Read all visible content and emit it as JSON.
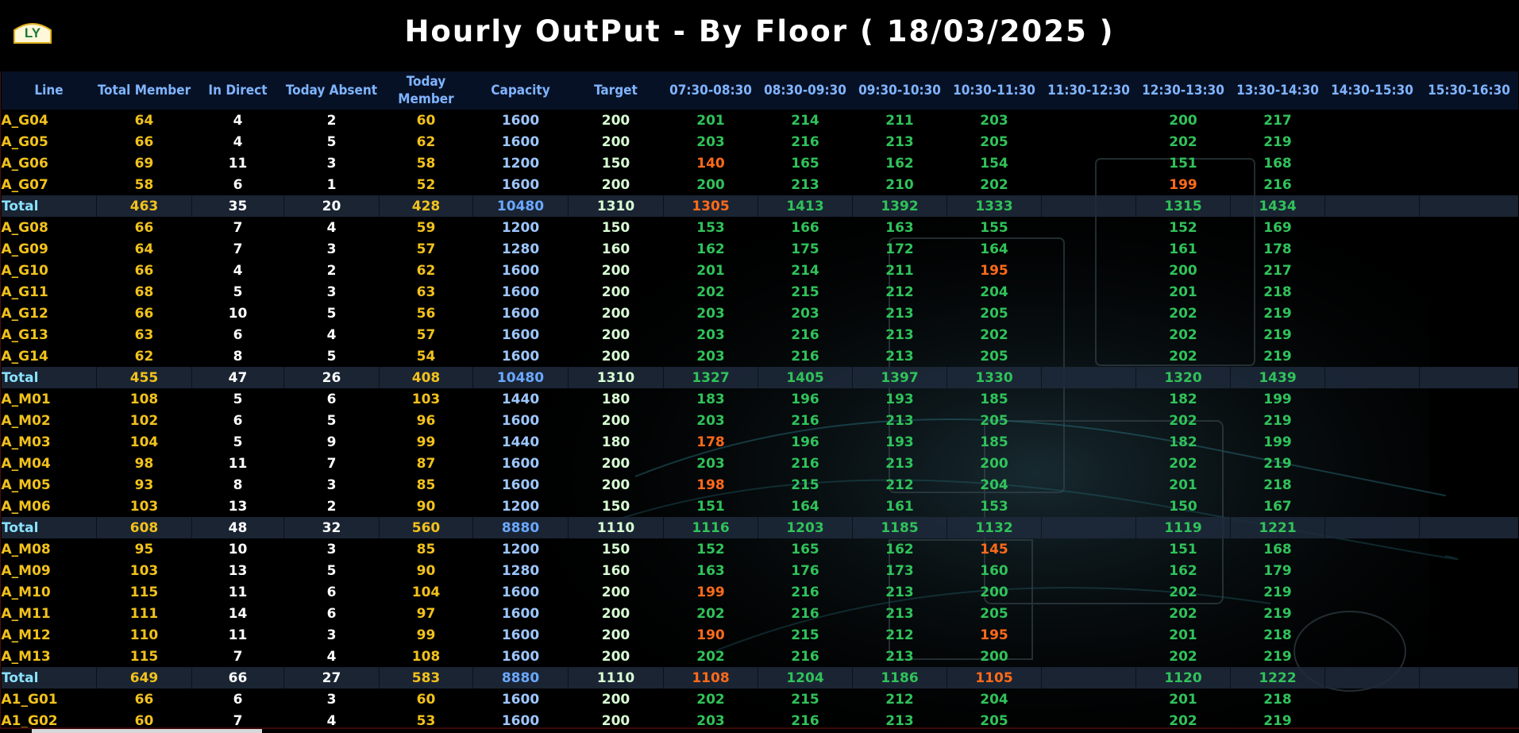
{
  "header": {
    "title": "Hourly OutPut - By Floor ( 18/03/2025 )",
    "logo_text": "LY"
  },
  "colors": {
    "line_and_members": "#f2c21c",
    "meets_target": "#30c25a",
    "below_target": "#ff6a1a",
    "header_text": "#7fb4ff",
    "total_row_bg": "#1e2a3c"
  },
  "columns": [
    "Line",
    "Total Member",
    "In Direct",
    "Today Absent",
    "Today Member",
    "Capacity",
    "Target",
    "07:30-08:30",
    "08:30-09:30",
    "09:30-10:30",
    "10:30-11:30",
    "11:30-12:30",
    "12:30-13:30",
    "13:30-14:30",
    "14:30-15:30",
    "15:30-16:30"
  ],
  "rows": [
    {
      "line": "A_G04",
      "total": "64",
      "indirect": "4",
      "absent": "2",
      "today": "60",
      "capacity": "1600",
      "target": "200",
      "h": [
        "201",
        "214",
        "211",
        "203",
        "",
        "200",
        "217",
        "",
        ""
      ],
      "s": [
        "ok",
        "ok",
        "ok",
        "ok",
        "",
        "ok",
        "ok",
        "",
        ""
      ]
    },
    {
      "line": "A_G05",
      "total": "66",
      "indirect": "4",
      "absent": "5",
      "today": "62",
      "capacity": "1600",
      "target": "200",
      "h": [
        "203",
        "216",
        "213",
        "205",
        "",
        "202",
        "219",
        "",
        ""
      ],
      "s": [
        "ok",
        "ok",
        "ok",
        "ok",
        "",
        "ok",
        "ok",
        "",
        ""
      ]
    },
    {
      "line": "A_G06",
      "total": "69",
      "indirect": "11",
      "absent": "3",
      "today": "58",
      "capacity": "1200",
      "target": "150",
      "h": [
        "140",
        "165",
        "162",
        "154",
        "",
        "151",
        "168",
        "",
        ""
      ],
      "s": [
        "low",
        "ok",
        "ok",
        "ok",
        "",
        "ok",
        "ok",
        "",
        ""
      ]
    },
    {
      "line": "A_G07",
      "total": "58",
      "indirect": "6",
      "absent": "1",
      "today": "52",
      "capacity": "1600",
      "target": "200",
      "h": [
        "200",
        "213",
        "210",
        "202",
        "",
        "199",
        "216",
        "",
        ""
      ],
      "s": [
        "ok",
        "ok",
        "ok",
        "ok",
        "",
        "low",
        "ok",
        "",
        ""
      ]
    },
    {
      "line": "Total",
      "total": "463",
      "indirect": "35",
      "absent": "20",
      "today": "428",
      "capacity": "10480",
      "target": "1310",
      "h": [
        "1305",
        "1413",
        "1392",
        "1333",
        "",
        "1315",
        "1434",
        "",
        ""
      ],
      "s": [
        "low",
        "ok",
        "ok",
        "ok",
        "",
        "ok",
        "ok",
        "",
        ""
      ],
      "is_total": true
    },
    {
      "line": "A_G08",
      "total": "66",
      "indirect": "7",
      "absent": "4",
      "today": "59",
      "capacity": "1200",
      "target": "150",
      "h": [
        "153",
        "166",
        "163",
        "155",
        "",
        "152",
        "169",
        "",
        ""
      ],
      "s": [
        "ok",
        "ok",
        "ok",
        "ok",
        "",
        "ok",
        "ok",
        "",
        ""
      ]
    },
    {
      "line": "A_G09",
      "total": "64",
      "indirect": "7",
      "absent": "3",
      "today": "57",
      "capacity": "1280",
      "target": "160",
      "h": [
        "162",
        "175",
        "172",
        "164",
        "",
        "161",
        "178",
        "",
        ""
      ],
      "s": [
        "ok",
        "ok",
        "ok",
        "ok",
        "",
        "ok",
        "ok",
        "",
        ""
      ]
    },
    {
      "line": "A_G10",
      "total": "66",
      "indirect": "4",
      "absent": "2",
      "today": "62",
      "capacity": "1600",
      "target": "200",
      "h": [
        "201",
        "214",
        "211",
        "195",
        "",
        "200",
        "217",
        "",
        ""
      ],
      "s": [
        "ok",
        "ok",
        "ok",
        "low",
        "",
        "ok",
        "ok",
        "",
        ""
      ]
    },
    {
      "line": "A_G11",
      "total": "68",
      "indirect": "5",
      "absent": "3",
      "today": "63",
      "capacity": "1600",
      "target": "200",
      "h": [
        "202",
        "215",
        "212",
        "204",
        "",
        "201",
        "218",
        "",
        ""
      ],
      "s": [
        "ok",
        "ok",
        "ok",
        "ok",
        "",
        "ok",
        "ok",
        "",
        ""
      ]
    },
    {
      "line": "A_G12",
      "total": "66",
      "indirect": "10",
      "absent": "5",
      "today": "56",
      "capacity": "1600",
      "target": "200",
      "h": [
        "203",
        "203",
        "213",
        "205",
        "",
        "202",
        "219",
        "",
        ""
      ],
      "s": [
        "ok",
        "ok",
        "ok",
        "ok",
        "",
        "ok",
        "ok",
        "",
        ""
      ]
    },
    {
      "line": "A_G13",
      "total": "63",
      "indirect": "6",
      "absent": "4",
      "today": "57",
      "capacity": "1600",
      "target": "200",
      "h": [
        "203",
        "216",
        "213",
        "202",
        "",
        "202",
        "219",
        "",
        ""
      ],
      "s": [
        "ok",
        "ok",
        "ok",
        "ok",
        "",
        "ok",
        "ok",
        "",
        ""
      ]
    },
    {
      "line": "A_G14",
      "total": "62",
      "indirect": "8",
      "absent": "5",
      "today": "54",
      "capacity": "1600",
      "target": "200",
      "h": [
        "203",
        "216",
        "213",
        "205",
        "",
        "202",
        "219",
        "",
        ""
      ],
      "s": [
        "ok",
        "ok",
        "ok",
        "ok",
        "",
        "ok",
        "ok",
        "",
        ""
      ]
    },
    {
      "line": "Total",
      "total": "455",
      "indirect": "47",
      "absent": "26",
      "today": "408",
      "capacity": "10480",
      "target": "1310",
      "h": [
        "1327",
        "1405",
        "1397",
        "1330",
        "",
        "1320",
        "1439",
        "",
        ""
      ],
      "s": [
        "ok",
        "ok",
        "ok",
        "ok",
        "",
        "ok",
        "ok",
        "",
        ""
      ],
      "is_total": true
    },
    {
      "line": "A_M01",
      "total": "108",
      "indirect": "5",
      "absent": "6",
      "today": "103",
      "capacity": "1440",
      "target": "180",
      "h": [
        "183",
        "196",
        "193",
        "185",
        "",
        "182",
        "199",
        "",
        ""
      ],
      "s": [
        "ok",
        "ok",
        "ok",
        "ok",
        "",
        "ok",
        "ok",
        "",
        ""
      ]
    },
    {
      "line": "A_M02",
      "total": "102",
      "indirect": "6",
      "absent": "5",
      "today": "96",
      "capacity": "1600",
      "target": "200",
      "h": [
        "203",
        "216",
        "213",
        "205",
        "",
        "202",
        "219",
        "",
        ""
      ],
      "s": [
        "ok",
        "ok",
        "ok",
        "ok",
        "",
        "ok",
        "ok",
        "",
        ""
      ]
    },
    {
      "line": "A_M03",
      "total": "104",
      "indirect": "5",
      "absent": "9",
      "today": "99",
      "capacity": "1440",
      "target": "180",
      "h": [
        "178",
        "196",
        "193",
        "185",
        "",
        "182",
        "199",
        "",
        ""
      ],
      "s": [
        "low",
        "ok",
        "ok",
        "ok",
        "",
        "ok",
        "ok",
        "",
        ""
      ]
    },
    {
      "line": "A_M04",
      "total": "98",
      "indirect": "11",
      "absent": "7",
      "today": "87",
      "capacity": "1600",
      "target": "200",
      "h": [
        "203",
        "216",
        "213",
        "200",
        "",
        "202",
        "219",
        "",
        ""
      ],
      "s": [
        "ok",
        "ok",
        "ok",
        "ok",
        "",
        "ok",
        "ok",
        "",
        ""
      ]
    },
    {
      "line": "A_M05",
      "total": "93",
      "indirect": "8",
      "absent": "3",
      "today": "85",
      "capacity": "1600",
      "target": "200",
      "h": [
        "198",
        "215",
        "212",
        "204",
        "",
        "201",
        "218",
        "",
        ""
      ],
      "s": [
        "low",
        "ok",
        "ok",
        "ok",
        "",
        "ok",
        "ok",
        "",
        ""
      ]
    },
    {
      "line": "A_M06",
      "total": "103",
      "indirect": "13",
      "absent": "2",
      "today": "90",
      "capacity": "1200",
      "target": "150",
      "h": [
        "151",
        "164",
        "161",
        "153",
        "",
        "150",
        "167",
        "",
        ""
      ],
      "s": [
        "ok",
        "ok",
        "ok",
        "ok",
        "",
        "ok",
        "ok",
        "",
        ""
      ]
    },
    {
      "line": "Total",
      "total": "608",
      "indirect": "48",
      "absent": "32",
      "today": "560",
      "capacity": "8880",
      "target": "1110",
      "h": [
        "1116",
        "1203",
        "1185",
        "1132",
        "",
        "1119",
        "1221",
        "",
        ""
      ],
      "s": [
        "ok",
        "ok",
        "ok",
        "ok",
        "",
        "ok",
        "ok",
        "",
        ""
      ],
      "is_total": true
    },
    {
      "line": "A_M08",
      "total": "95",
      "indirect": "10",
      "absent": "3",
      "today": "85",
      "capacity": "1200",
      "target": "150",
      "h": [
        "152",
        "165",
        "162",
        "145",
        "",
        "151",
        "168",
        "",
        ""
      ],
      "s": [
        "ok",
        "ok",
        "ok",
        "low",
        "",
        "ok",
        "ok",
        "",
        ""
      ]
    },
    {
      "line": "A_M09",
      "total": "103",
      "indirect": "13",
      "absent": "5",
      "today": "90",
      "capacity": "1280",
      "target": "160",
      "h": [
        "163",
        "176",
        "173",
        "160",
        "",
        "162",
        "179",
        "",
        ""
      ],
      "s": [
        "ok",
        "ok",
        "ok",
        "ok",
        "",
        "ok",
        "ok",
        "",
        ""
      ]
    },
    {
      "line": "A_M10",
      "total": "115",
      "indirect": "11",
      "absent": "6",
      "today": "104",
      "capacity": "1600",
      "target": "200",
      "h": [
        "199",
        "216",
        "213",
        "200",
        "",
        "202",
        "219",
        "",
        ""
      ],
      "s": [
        "low",
        "ok",
        "ok",
        "ok",
        "",
        "ok",
        "ok",
        "",
        ""
      ]
    },
    {
      "line": "A_M11",
      "total": "111",
      "indirect": "14",
      "absent": "6",
      "today": "97",
      "capacity": "1600",
      "target": "200",
      "h": [
        "202",
        "216",
        "213",
        "205",
        "",
        "202",
        "219",
        "",
        ""
      ],
      "s": [
        "ok",
        "ok",
        "ok",
        "ok",
        "",
        "ok",
        "ok",
        "",
        ""
      ]
    },
    {
      "line": "A_M12",
      "total": "110",
      "indirect": "11",
      "absent": "3",
      "today": "99",
      "capacity": "1600",
      "target": "200",
      "h": [
        "190",
        "215",
        "212",
        "195",
        "",
        "201",
        "218",
        "",
        ""
      ],
      "s": [
        "low",
        "ok",
        "ok",
        "low",
        "",
        "ok",
        "ok",
        "",
        ""
      ]
    },
    {
      "line": "A_M13",
      "total": "115",
      "indirect": "7",
      "absent": "4",
      "today": "108",
      "capacity": "1600",
      "target": "200",
      "h": [
        "202",
        "216",
        "213",
        "200",
        "",
        "202",
        "219",
        "",
        ""
      ],
      "s": [
        "ok",
        "ok",
        "ok",
        "ok",
        "",
        "ok",
        "ok",
        "",
        ""
      ]
    },
    {
      "line": "Total",
      "total": "649",
      "indirect": "66",
      "absent": "27",
      "today": "583",
      "capacity": "8880",
      "target": "1110",
      "h": [
        "1108",
        "1204",
        "1186",
        "1105",
        "",
        "1120",
        "1222",
        "",
        ""
      ],
      "s": [
        "low",
        "ok",
        "ok",
        "low",
        "",
        "ok",
        "ok",
        "",
        ""
      ],
      "is_total": true
    },
    {
      "line": "A1_G01",
      "total": "66",
      "indirect": "6",
      "absent": "3",
      "today": "60",
      "capacity": "1600",
      "target": "200",
      "h": [
        "202",
        "215",
        "212",
        "204",
        "",
        "201",
        "218",
        "",
        ""
      ],
      "s": [
        "ok",
        "ok",
        "ok",
        "ok",
        "",
        "ok",
        "ok",
        "",
        ""
      ]
    },
    {
      "line": "A1_G02",
      "total": "60",
      "indirect": "7",
      "absent": "4",
      "today": "53",
      "capacity": "1600",
      "target": "200",
      "h": [
        "203",
        "216",
        "213",
        "205",
        "",
        "202",
        "219",
        "",
        ""
      ],
      "s": [
        "ok",
        "ok",
        "ok",
        "ok",
        "",
        "ok",
        "ok",
        "",
        ""
      ]
    }
  ]
}
